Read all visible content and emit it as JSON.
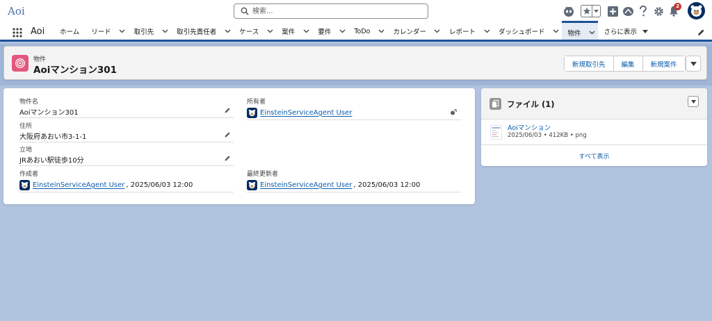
{
  "app": {
    "logo_text": "Aoi",
    "name": "Aoi"
  },
  "search": {
    "placeholder": "検索..."
  },
  "header": {
    "notification_count": "2"
  },
  "nav": {
    "items": [
      {
        "label": "ホーム",
        "has_menu": false
      },
      {
        "label": "リード",
        "has_menu": true
      },
      {
        "label": "取引先",
        "has_menu": true
      },
      {
        "label": "取引先責任者",
        "has_menu": true
      },
      {
        "label": "ケース",
        "has_menu": true
      },
      {
        "label": "案件",
        "has_menu": true
      },
      {
        "label": "要件",
        "has_menu": true
      },
      {
        "label": "ToDo",
        "has_menu": true
      },
      {
        "label": "カレンダー",
        "has_menu": true
      },
      {
        "label": "レポート",
        "has_menu": true
      },
      {
        "label": "ダッシュボード",
        "has_menu": true
      },
      {
        "label": "物件",
        "has_menu": true,
        "active": true
      }
    ],
    "more_label": "さらに表示"
  },
  "record": {
    "object_type": "物件",
    "title": "Aoiマンション301",
    "actions": [
      "新規取引先",
      "編集",
      "新規案件"
    ]
  },
  "details": {
    "property_name": {
      "label": "物件名",
      "value": "Aoiマンション301"
    },
    "address": {
      "label": "住所",
      "value": "大阪府あおい市3-1-1"
    },
    "location": {
      "label": "立地",
      "value": "JRあおい駅徒歩10分"
    },
    "created_by": {
      "label": "作成者",
      "user": "EinsteinServiceAgent User",
      "datetime": ", 2025/06/03 12:00"
    },
    "owner": {
      "label": "所有者",
      "user": "EinsteinServiceAgent User"
    },
    "last_modified_by": {
      "label": "最終更新者",
      "user": "EinsteinServiceAgent User",
      "datetime": ", 2025/06/03 12:00"
    }
  },
  "files": {
    "title": "ファイル (1)",
    "items": [
      {
        "name": "Aoiマンション",
        "meta": "2025/06/03 • 412KB • png"
      }
    ],
    "view_all": "すべて表示"
  },
  "colors": {
    "brand": "#1b5297",
    "link": "#0b5cab",
    "object_icon": "#e3577a",
    "background": "#b0c3df",
    "badge": "#c23934"
  }
}
